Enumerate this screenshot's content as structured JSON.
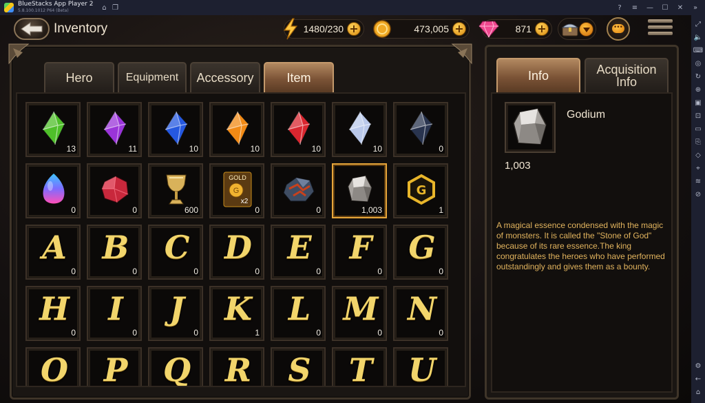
{
  "window": {
    "app_title": "BlueStacks App Player 2",
    "app_version": "5.8.100.1012 P64 (Beta)"
  },
  "header": {
    "title": "Inventory",
    "energy": "1480/230",
    "gold": "473,005",
    "gems": "871"
  },
  "tabs": [
    {
      "label": "Hero"
    },
    {
      "label": "Equipment"
    },
    {
      "label": "Accessory"
    },
    {
      "label": "Item"
    }
  ],
  "info_tabs": [
    {
      "label": "Info"
    },
    {
      "label": "Acquisition Info"
    }
  ],
  "items": [
    {
      "icon": "green-crystal",
      "color": "#4fbf2a",
      "count": "13"
    },
    {
      "icon": "purple-crystal",
      "color": "#9a34d9",
      "count": "11"
    },
    {
      "icon": "blue-crystal",
      "color": "#2558e0",
      "count": "10"
    },
    {
      "icon": "orange-crystal",
      "color": "#f28a15",
      "count": "10"
    },
    {
      "icon": "red-crystal",
      "color": "#d9262f",
      "count": "10"
    },
    {
      "icon": "white-crystal",
      "color": "#b9c8ea",
      "count": "10"
    },
    {
      "icon": "dark-crystal",
      "color": "#29344f",
      "count": "0"
    },
    {
      "icon": "rainbow-egg",
      "color": "#7d8cff",
      "count": "0"
    },
    {
      "icon": "ruby-ore",
      "color": "#c8283c",
      "count": "0"
    },
    {
      "icon": "golden-chalice",
      "color": "#c9a249",
      "count": "600"
    },
    {
      "icon": "gold-x2-card",
      "color": "#c88d1c",
      "count": "0",
      "card_top": "GOLD",
      "card_bottom": "x2"
    },
    {
      "icon": "magma-ore",
      "color": "#c8411c",
      "count": "0"
    },
    {
      "icon": "godium-stone",
      "color": "#c9c5c0",
      "count": "1,003"
    },
    {
      "icon": "g-hexagon-token",
      "color": "#e8b52a",
      "count": "1"
    },
    {
      "letter": "A",
      "count": "0"
    },
    {
      "letter": "B",
      "count": "0"
    },
    {
      "letter": "C",
      "count": "0"
    },
    {
      "letter": "D",
      "count": "0"
    },
    {
      "letter": "E",
      "count": "0"
    },
    {
      "letter": "F",
      "count": "0"
    },
    {
      "letter": "G",
      "count": "0"
    },
    {
      "letter": "H",
      "count": "0"
    },
    {
      "letter": "I",
      "count": "0"
    },
    {
      "letter": "J",
      "count": "0"
    },
    {
      "letter": "K",
      "count": "1"
    },
    {
      "letter": "L",
      "count": "0"
    },
    {
      "letter": "M",
      "count": "0"
    },
    {
      "letter": "N",
      "count": "0"
    },
    {
      "letter": "O",
      "count": ""
    },
    {
      "letter": "P",
      "count": ""
    },
    {
      "letter": "Q",
      "count": ""
    },
    {
      "letter": "R",
      "count": ""
    },
    {
      "letter": "S",
      "count": ""
    },
    {
      "letter": "T",
      "count": ""
    },
    {
      "letter": "U",
      "count": ""
    }
  ],
  "detail": {
    "name": "Godium",
    "count": "1,003",
    "description": "A magical essence condensed with the magic of monsters. It is called the \"Stone of God\" because of its rare essence.The king congratulates the heroes who have performed outstandingly and gives them as a bounty."
  },
  "colors": {
    "accent_gold": "#e7a63a",
    "desc_text": "#e2b45e",
    "active_tab": "#9a6b45"
  }
}
